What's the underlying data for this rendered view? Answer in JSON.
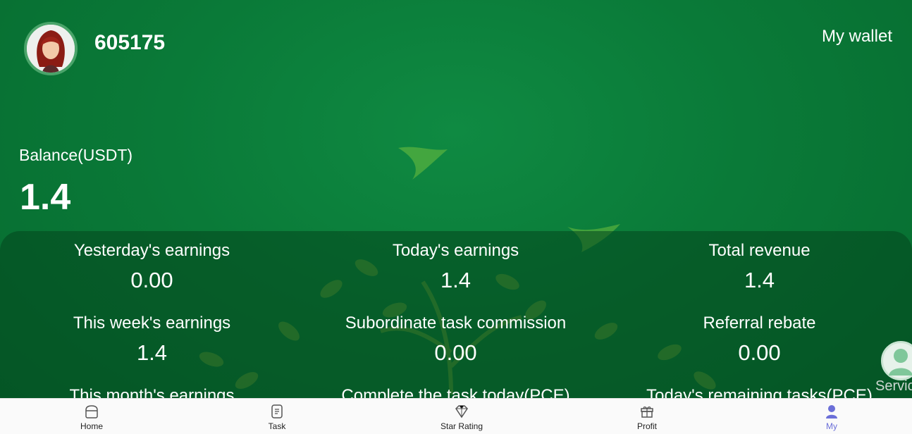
{
  "header": {
    "username": "605175",
    "wallet_label": "My wallet"
  },
  "balance": {
    "label": "Balance(USDT)",
    "value": "1.4"
  },
  "stats": [
    {
      "label": "Yesterday's earnings",
      "value": "0.00"
    },
    {
      "label": "Today's earnings",
      "value": "1.4"
    },
    {
      "label": "Total revenue",
      "value": "1.4"
    },
    {
      "label": "This week's earnings",
      "value": "1.4"
    },
    {
      "label": "Subordinate task commission",
      "value": "0.00"
    },
    {
      "label": "Referral rebate",
      "value": "0.00"
    },
    {
      "label": "This month's earnings",
      "value": ""
    },
    {
      "label": "Complete the task today(PCE)",
      "value": ""
    },
    {
      "label": "Today's remaining tasks(PCE)",
      "value": ""
    }
  ],
  "service": {
    "label": "Servic"
  },
  "tabs": [
    {
      "label": "Home",
      "icon": "home-icon"
    },
    {
      "label": "Task",
      "icon": "task-icon"
    },
    {
      "label": "Star Rating",
      "icon": "diamond-icon"
    },
    {
      "label": "Profit",
      "icon": "gift-icon"
    },
    {
      "label": "My",
      "icon": "user-icon",
      "active": true
    }
  ],
  "colors": {
    "background": "#0b7a3a",
    "panel": "#03461e",
    "active_tab": "#6b6fd8"
  }
}
